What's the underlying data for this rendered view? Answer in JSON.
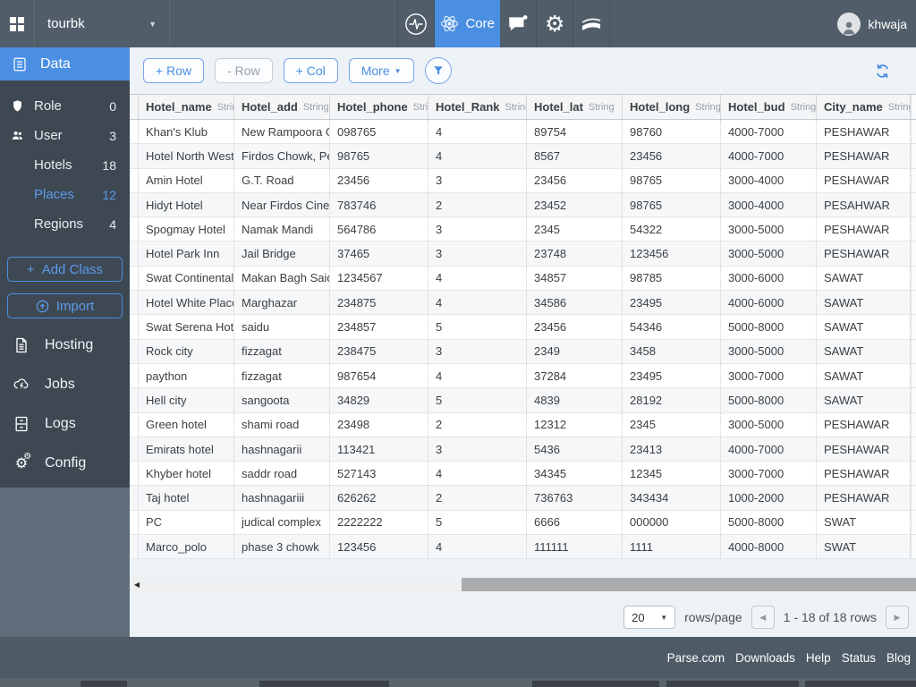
{
  "topbar": {
    "app_name": "tourbk",
    "app_caret": "▼",
    "core_tab": "Core",
    "user_name": "khwaja"
  },
  "sidebar": {
    "data_label": "Data",
    "classes": [
      {
        "label": "Role",
        "count": "0",
        "icon": "shield-icon",
        "active": false
      },
      {
        "label": "User",
        "count": "3",
        "icon": "users-icon",
        "active": false
      },
      {
        "label": "Hotels",
        "count": "18",
        "icon": "",
        "active": false
      },
      {
        "label": "Places",
        "count": "12",
        "icon": "",
        "active": true
      },
      {
        "label": "Regions",
        "count": "4",
        "icon": "",
        "active": false
      }
    ],
    "add_class_plus": "+",
    "add_class_label": "Add Class",
    "import_label": "Import",
    "sections": [
      {
        "label": "Hosting",
        "icon": "document-icon"
      },
      {
        "label": "Jobs",
        "icon": "cloud-lightning-icon"
      },
      {
        "label": "Logs",
        "icon": "cabinet-icon"
      },
      {
        "label": "Config",
        "icon": "gears-icon"
      }
    ]
  },
  "toolbar": {
    "add_row": "+ Row",
    "remove_row": "- Row",
    "add_col": "+ Col",
    "more": "More",
    "more_caret": "▼"
  },
  "table": {
    "columns": [
      {
        "name": "Hotel_name",
        "type": "String"
      },
      {
        "name": "Hotel_add",
        "type": "String"
      },
      {
        "name": "Hotel_phone",
        "type": "String"
      },
      {
        "name": "Hotel_Rank",
        "type": "String"
      },
      {
        "name": "Hotel_lat",
        "type": "String"
      },
      {
        "name": "Hotel_long",
        "type": "String"
      },
      {
        "name": "Hotel_bud",
        "type": "String"
      },
      {
        "name": "City_name",
        "type": "String"
      }
    ],
    "rows": [
      [
        "Khan's Klub",
        "New Rampoora Gate",
        "098765",
        "4",
        "89754",
        "98760",
        "4000-7000",
        "PESHAWAR"
      ],
      [
        "Hotel North West He...",
        "Firdos Chowk, Pesh...",
        "98765",
        "4",
        "8567",
        "23456",
        "4000-7000",
        "PESHAWAR"
      ],
      [
        "Amin Hotel",
        "G.T. Road",
        "23456",
        "3",
        "23456",
        "98765",
        "3000-4000",
        "PESHAWAR"
      ],
      [
        "Hidyt Hotel",
        "Near Firdos Cinema",
        "783746",
        "2",
        "23452",
        "98765",
        "3000-4000",
        "PESAHWAR"
      ],
      [
        "Spogmay Hotel",
        "Namak Mandi",
        "564786",
        "3",
        "2345",
        "54322",
        "3000-5000",
        "PESHAWAR"
      ],
      [
        "Hotel Park Inn",
        "Jail Bridge",
        "37465",
        "3",
        "23748",
        "123456",
        "3000-5000",
        "PESHAWAR"
      ],
      [
        "Swat Continental Ho...",
        "Makan Bagh Saidu S...",
        "1234567",
        "4",
        "34857",
        "98785",
        "3000-6000",
        "SAWAT"
      ],
      [
        "Hotel White Place",
        "Marghazar",
        "234875",
        "4",
        "34586",
        "23495",
        "4000-6000",
        "SAWAT"
      ],
      [
        "Swat Serena Hotel",
        "saidu",
        "234857",
        "5",
        "23456",
        "54346",
        "5000-8000",
        "SAWAT"
      ],
      [
        "Rock city",
        "fizzagat",
        "238475",
        "3",
        "2349",
        "3458",
        "3000-5000",
        "SAWAT"
      ],
      [
        "paython",
        "fizzagat",
        "987654",
        "4",
        "37284",
        "23495",
        "3000-7000",
        "SAWAT"
      ],
      [
        "Hell city",
        "sangoota",
        "34829",
        "5",
        "4839",
        "28192",
        "5000-8000",
        "SAWAT"
      ],
      [
        "Green hotel",
        "shami road",
        "23498",
        "2",
        "12312",
        "2345",
        "3000-5000",
        "PESHAWAR"
      ],
      [
        "Emirats hotel",
        "hashnagarii",
        "113421",
        "3",
        "5436",
        "23413",
        "4000-7000",
        "PESHAWAR"
      ],
      [
        "Khyber hotel",
        "saddr road",
        "527143",
        "4",
        "34345",
        "12345",
        "3000-7000",
        "PESHAWAR"
      ],
      [
        "Taj hotel",
        "hashnagariii",
        "626262",
        "2",
        "736763",
        "343434",
        "1000-2000",
        "PESHAWAR"
      ],
      [
        "PC",
        "judical complex",
        "2222222",
        "5",
        "6666",
        "000000",
        "5000-8000",
        "SWAT"
      ],
      [
        "Marco_polo",
        "phase 3 chowk",
        "123456",
        "4",
        "111111",
        "1111",
        "4000-8000",
        "SWAT"
      ]
    ]
  },
  "hscrollbar": {
    "left_arrow": "◀"
  },
  "pagination": {
    "rows_per_page": "20",
    "caret": "▼",
    "rows_per_page_label": "rows/page",
    "prev": "◀",
    "range": "1 - 18 of 18 rows",
    "next": "▶"
  },
  "footer": {
    "links": [
      "Parse.com",
      "Downloads",
      "Help",
      "Status",
      "Blog"
    ]
  },
  "colors": {
    "brand_blue": "#4b8fe2",
    "topbar_bg": "#515e6a",
    "sidebar_bg": "#3e4853",
    "sidebar_lower_bg": "#5f6d7a",
    "footer_bg": "#4e5b67",
    "main_bg": "#edf2f6",
    "row_alt_bg": "#f5f7f9"
  }
}
